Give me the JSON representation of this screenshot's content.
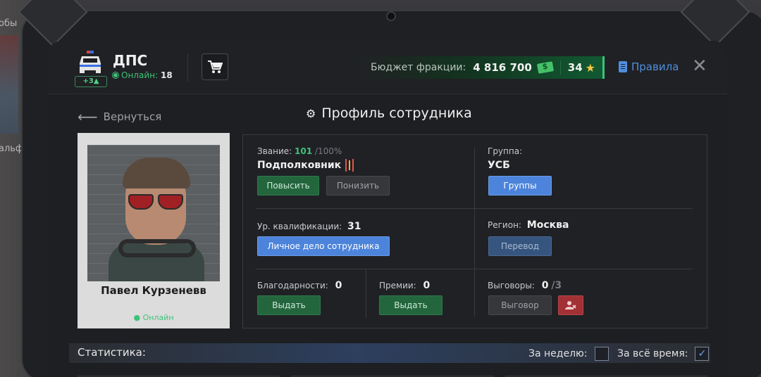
{
  "header": {
    "faction_name": "ДПС",
    "level_badge": "+3▲",
    "online_label": "Онлайн:",
    "online_count": "18",
    "budget_label": "Бюджет фракции:",
    "budget_value": "4 816 700",
    "stars_value": "34",
    "rules_label": "Правила"
  },
  "nav": {
    "back_label": "Вернуться",
    "page_title": "Профиль сотрудника"
  },
  "employee": {
    "name": "Павел Курзеневв",
    "status": "Онлайн"
  },
  "profile": {
    "rank_label": "Звание:",
    "rank_progress": "101",
    "rank_max": "/100%",
    "rank_name": "Подполковник",
    "promote_button": "Повысить",
    "demote_button": "Понизить",
    "group_label": "Группа:",
    "group_value": "УСБ",
    "groups_button": "Группы",
    "qualification_label": "Ур. квалификации:",
    "qualification_value": "31",
    "personal_file_button": "Личное дело сотрудника",
    "region_label": "Регион:",
    "region_value": "Москва",
    "transfer_button": "Перевод",
    "thanks_label": "Благодарности:",
    "thanks_value": "0",
    "thanks_button": "Выдать",
    "bonuses_label": "Премии:",
    "bonuses_value": "0",
    "bonuses_button": "Выдать",
    "reprimands_label": "Выговоры:",
    "reprimands_value": "0",
    "reprimands_max": "/3",
    "reprimand_button": "Выговор"
  },
  "stats": {
    "title": "Статистика:",
    "week_label": "За неделю:",
    "week_checked": false,
    "alltime_label": "За всё время:",
    "alltime_checked": true
  },
  "background": {
    "text_1": "обы",
    "text_2": "альф"
  },
  "colors": {
    "accent_green": "#3ec27a",
    "accent_blue": "#4d84db",
    "danger_red": "#a23136",
    "panel_bg": "#202125"
  }
}
